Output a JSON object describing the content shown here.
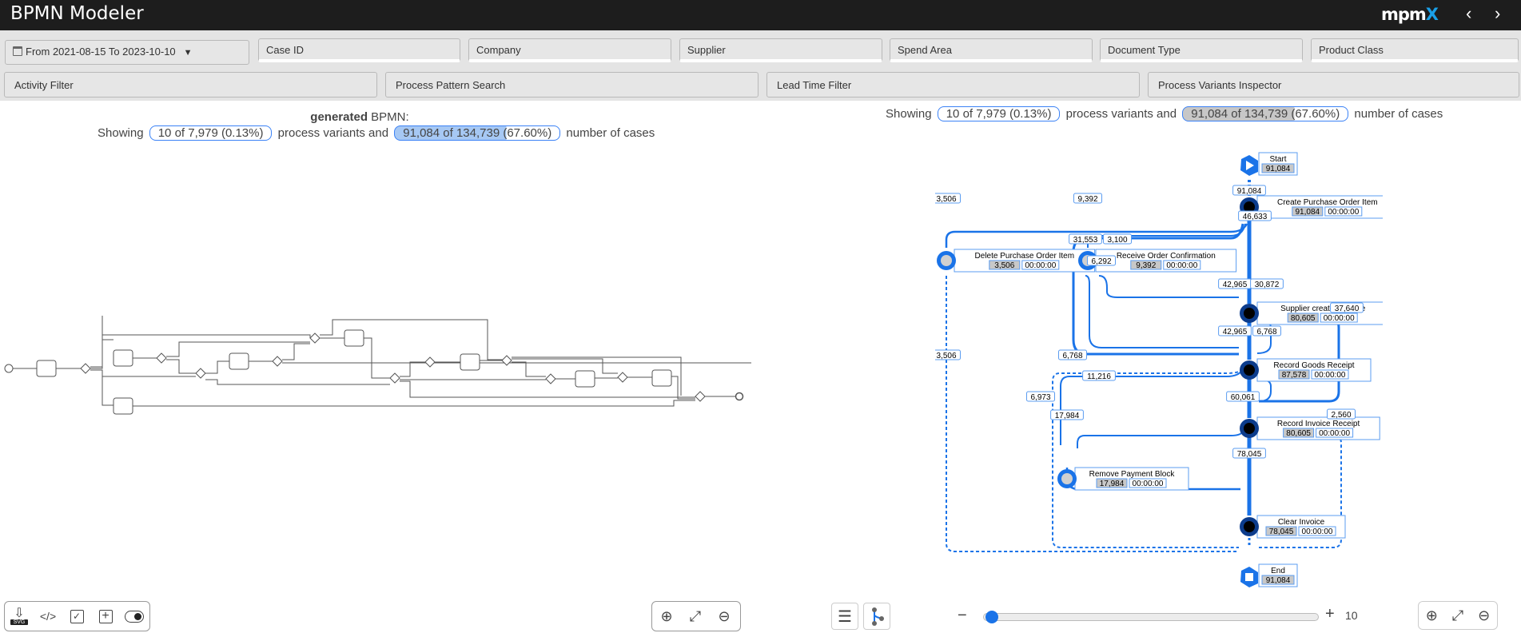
{
  "app": {
    "title": "BPMN Modeler",
    "logo": "mpm",
    "logo_accent": "X"
  },
  "nav": {
    "back_icon": "chevron-left-icon",
    "forward_icon": "chevron-right-icon"
  },
  "filters": {
    "date_range": "From 2021-08-15 To 2023-10-10",
    "row1": [
      "Case ID",
      "Company",
      "Supplier",
      "Spend Area",
      "Document Type",
      "Product Class"
    ],
    "row2": [
      "Activity Filter",
      "Process Pattern Search",
      "Lead Time Filter",
      "Process Variants Inspector"
    ]
  },
  "left_panel": {
    "title_bold": "generated",
    "title_rest": "BPMN:",
    "showing": "Showing",
    "variants_pill": "10 of 7,979 (0.13%)",
    "variants_text": "process variants and",
    "cases_pill": "91,084 of 134,739 (67.60%)",
    "cases_text": "number of cases",
    "cases_fraction": 0.676
  },
  "right_panel": {
    "showing": "Showing",
    "variants_pill": "10 of 7,979 (0.13%)",
    "variants_text": "process variants and",
    "cases_pill": "91,084 of 134,739 (67.60%)",
    "cases_text": "number of cases"
  },
  "process_map": {
    "nodes": [
      {
        "id": "start",
        "label": "Start",
        "count": "91,084"
      },
      {
        "id": "cpoi",
        "label": "Create Purchase Order Item",
        "count": "91,084",
        "time": "00:00:00"
      },
      {
        "id": "dpoi",
        "label": "Delete Purchase Order Item",
        "count": "3,506",
        "time": "00:00:00"
      },
      {
        "id": "roc",
        "label": "Receive Order Confirmation",
        "count": "9,392",
        "time": "00:00:00"
      },
      {
        "id": "sci",
        "label": "Supplier creates invoice",
        "count": "80,605",
        "time": "00:00:00"
      },
      {
        "id": "rgr",
        "label": "Record Goods Receipt",
        "count": "87,578",
        "time": "00:00:00"
      },
      {
        "id": "rir",
        "label": "Record Invoice Receipt",
        "count": "80,605",
        "time": "00:00:00"
      },
      {
        "id": "rpb",
        "label": "Remove Payment Block",
        "count": "17,984",
        "time": "00:00:00"
      },
      {
        "id": "ci",
        "label": "Clear Invoice",
        "count": "78,045",
        "time": "00:00:00"
      },
      {
        "id": "end",
        "label": "End",
        "count": "91,084"
      }
    ],
    "edge_labels": {
      "start_cpoi": "91,084",
      "cpoi_dpoi": "3,506",
      "cpoi_roc": "9,392",
      "cpoi_sci": "46,633",
      "cpoi_rgr": "31,553",
      "roc_sci": "3,100",
      "roc_rgr": "6,292",
      "sci_rgr": "42,965",
      "rgr_sci": "30,872",
      "sci_rir": "37,640",
      "rgr_rir": "42,965",
      "rir_rgr": "6,768",
      "rgr_rpb": "6,768",
      "rir_rpb": "11,216",
      "rgr_ci": "6,973",
      "rir_ci": "60,061",
      "rpb_ci": "17,984",
      "rir_end": "2,560",
      "dpoi_end": "3,506",
      "ci_end": "78,045"
    }
  },
  "left_toolbar": {
    "svg_label": "SVG",
    "items": [
      "download-svg-icon",
      "code-icon",
      "checkbox-icon",
      "add-icon",
      "toggle-icon"
    ]
  },
  "zoom_toolbar": [
    "zoom-in-icon",
    "fit-screen-icon",
    "zoom-out-icon"
  ],
  "slider": {
    "minus": "−",
    "plus": "+",
    "value": "10",
    "fraction": 0.0
  }
}
